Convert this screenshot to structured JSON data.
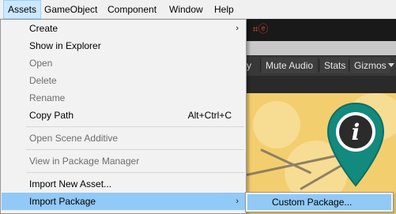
{
  "menubar": {
    "items": [
      {
        "label": "Assets"
      },
      {
        "label": "GameObject"
      },
      {
        "label": "Component"
      },
      {
        "label": "Window"
      },
      {
        "label": "Help"
      }
    ]
  },
  "game_toolbar": {
    "partial_label": "y",
    "mute_audio": "Mute Audio",
    "stats": "Stats",
    "gizmos": "Gizmos"
  },
  "toolbar_glyphs": [
    "⌗",
    "ⓔ"
  ],
  "assets_menu": {
    "items": [
      {
        "label": "Create",
        "enabled": true,
        "submenu": true
      },
      {
        "label": "Show in Explorer",
        "enabled": true
      },
      {
        "label": "Open",
        "enabled": false
      },
      {
        "label": "Delete",
        "enabled": false
      },
      {
        "label": "Rename",
        "enabled": false
      },
      {
        "label": "Copy Path",
        "enabled": true,
        "shortcut": "Alt+Ctrl+C"
      },
      {
        "label": "Open Scene Additive",
        "enabled": false
      },
      {
        "label": "View in Package Manager",
        "enabled": false
      },
      {
        "label": "Import New Asset...",
        "enabled": true
      },
      {
        "label": "Import Package",
        "enabled": true,
        "submenu": true,
        "highlighted": true
      }
    ]
  },
  "import_package_submenu": {
    "items": [
      {
        "label": "Custom Package...",
        "highlighted": true
      }
    ]
  },
  "scene_pin": {
    "glyph": "i",
    "color": "#128a7d"
  },
  "icons": {
    "submenu_arrow": "chevron-right-icon",
    "pin": "info-map-pin-icon",
    "dropdown": "dropdown-triangle-icon"
  }
}
